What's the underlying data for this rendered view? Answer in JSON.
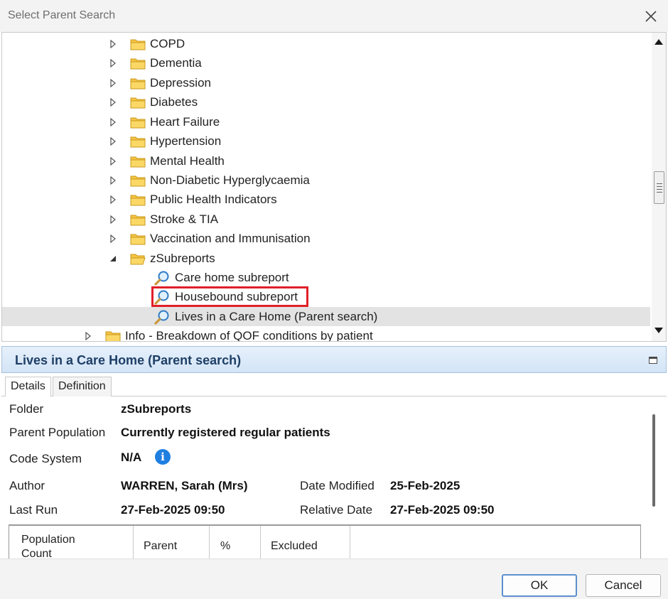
{
  "window": {
    "title": "Select Parent Search"
  },
  "tree": {
    "items": [
      {
        "label": "COPD",
        "type": "folder",
        "state": "collapsed"
      },
      {
        "label": "Dementia",
        "type": "folder",
        "state": "collapsed"
      },
      {
        "label": "Depression",
        "type": "folder",
        "state": "collapsed"
      },
      {
        "label": "Diabetes",
        "type": "folder",
        "state": "collapsed"
      },
      {
        "label": "Heart Failure",
        "type": "folder",
        "state": "collapsed"
      },
      {
        "label": "Hypertension",
        "type": "folder",
        "state": "collapsed"
      },
      {
        "label": "Mental Health",
        "type": "folder",
        "state": "collapsed"
      },
      {
        "label": "Non-Diabetic Hyperglycaemia",
        "type": "folder",
        "state": "collapsed"
      },
      {
        "label": "Public Health Indicators",
        "type": "folder",
        "state": "collapsed"
      },
      {
        "label": "Stroke & TIA",
        "type": "folder",
        "state": "collapsed"
      },
      {
        "label": "Vaccination and Immunisation",
        "type": "folder",
        "state": "collapsed"
      },
      {
        "label": "zSubreports",
        "type": "folder",
        "state": "expanded"
      },
      {
        "label": "Care home subreport",
        "type": "search"
      },
      {
        "label": "Housebound subreport",
        "type": "search",
        "highlighted": true
      },
      {
        "label": "Lives in a Care Home (Parent search)",
        "type": "search",
        "selected": true
      },
      {
        "label": "Info - Breakdown of QOF conditions by patient",
        "type": "folder",
        "state": "collapsed"
      }
    ]
  },
  "details": {
    "header_title": "Lives in a Care Home (Parent search)",
    "tabs": [
      {
        "label": "Details",
        "active": true
      },
      {
        "label": "Definition",
        "active": false
      }
    ],
    "folder_label": "Folder",
    "folder_value": "zSubreports",
    "parent_population_label": "Parent Population",
    "parent_population_value": "Currently registered regular patients",
    "code_system_label": "Code System",
    "code_system_value": "N/A",
    "author_label": "Author",
    "author_value": "WARREN, Sarah (Mrs)",
    "date_modified_label": "Date Modified",
    "date_modified_value": "25-Feb-2025",
    "last_run_label": "Last Run",
    "last_run_value": "27-Feb-2025 09:50",
    "relative_date_label": "Relative Date",
    "relative_date_value": "27-Feb-2025 09:50",
    "population_table": {
      "columns": [
        "Population Count",
        "Parent",
        "%",
        "Excluded"
      ]
    }
  },
  "footer": {
    "ok_label": "OK",
    "cancel_label": "Cancel"
  },
  "colors": {
    "highlight_border": "#e0202a",
    "header_text": "#1e3f66",
    "info_icon": "#1f7fe0",
    "folder": "#f6c443"
  }
}
